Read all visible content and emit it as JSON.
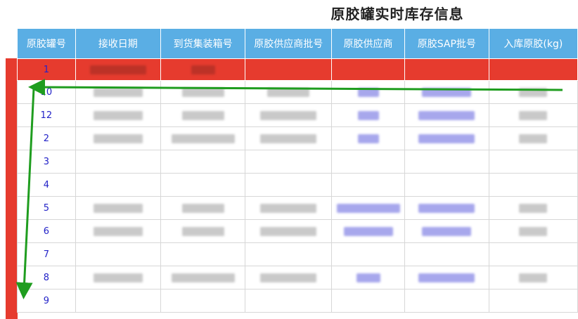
{
  "title": "原胶罐实时库存信息",
  "colors": {
    "header_bg": "#5aaee4",
    "highlight_row": "#e63b2e",
    "tank_number": "#2323c8",
    "arrow": "#1f9d1f"
  },
  "columns": [
    "原胶罐号",
    "接收日期",
    "到货集装箱号",
    "原胶供应商批号",
    "原胶供应商",
    "原胶SAP批号",
    "入库原胶(kg)"
  ],
  "rows": [
    {
      "tank": "1",
      "highlighted": true
    },
    {
      "tank": "10",
      "highlighted": false
    },
    {
      "tank": "12",
      "highlighted": false
    },
    {
      "tank": "2",
      "highlighted": false
    },
    {
      "tank": "3",
      "highlighted": false
    },
    {
      "tank": "4",
      "highlighted": false
    },
    {
      "tank": "5",
      "highlighted": false
    },
    {
      "tank": "6",
      "highlighted": false
    },
    {
      "tank": "7",
      "highlighted": false
    },
    {
      "tank": "8",
      "highlighted": false
    },
    {
      "tank": "9",
      "highlighted": false
    }
  ]
}
